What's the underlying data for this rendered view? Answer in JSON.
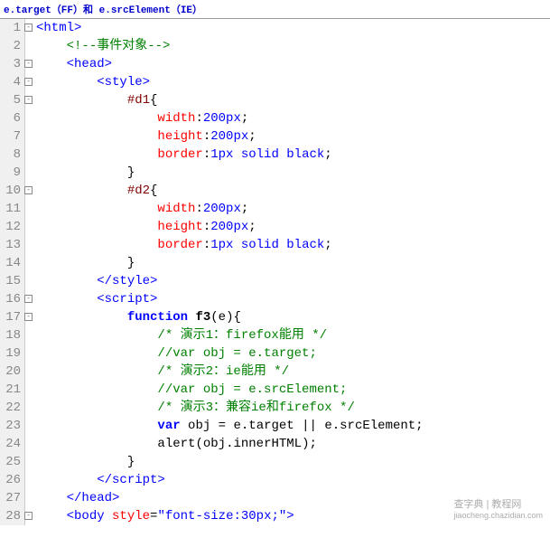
{
  "header": "e.target（FF）和 e.srcElement（IE）",
  "watermark": {
    "line1": "查字典 | 教程网",
    "line2": "jiaocheng.chazidian.com"
  },
  "lines": [
    {
      "num": "1",
      "fold": true,
      "html": "<span class='t-tag'>&lt;html&gt;</span>"
    },
    {
      "num": "2",
      "fold": false,
      "html": "    <span class='t-comment'>&lt;!--事件对象--&gt;</span>"
    },
    {
      "num": "3",
      "fold": true,
      "html": "    <span class='t-tag'>&lt;head&gt;</span>"
    },
    {
      "num": "4",
      "fold": true,
      "html": "        <span class='t-tag'>&lt;style&gt;</span>"
    },
    {
      "num": "5",
      "fold": true,
      "html": "            <span class='t-selector'>#d1</span><span class='t-punct'>{</span>"
    },
    {
      "num": "6",
      "fold": false,
      "html": "                <span class='t-prop'>width</span><span class='t-punct'>:</span><span class='t-val'>200px</span><span class='t-punct'>;</span>"
    },
    {
      "num": "7",
      "fold": false,
      "html": "                <span class='t-prop'>height</span><span class='t-punct'>:</span><span class='t-val'>200px</span><span class='t-punct'>;</span>"
    },
    {
      "num": "8",
      "fold": false,
      "html": "                <span class='t-prop'>border</span><span class='t-punct'>:</span><span class='t-val'>1px solid black</span><span class='t-punct'>;</span>"
    },
    {
      "num": "9",
      "fold": false,
      "html": "            <span class='t-punct'>}</span>"
    },
    {
      "num": "10",
      "fold": true,
      "html": "            <span class='t-selector'>#d2</span><span class='t-punct'>{</span>"
    },
    {
      "num": "11",
      "fold": false,
      "html": "                <span class='t-prop'>width</span><span class='t-punct'>:</span><span class='t-val'>200px</span><span class='t-punct'>;</span>"
    },
    {
      "num": "12",
      "fold": false,
      "html": "                <span class='t-prop'>height</span><span class='t-punct'>:</span><span class='t-val'>200px</span><span class='t-punct'>;</span>"
    },
    {
      "num": "13",
      "fold": false,
      "html": "                <span class='t-prop'>border</span><span class='t-punct'>:</span><span class='t-val'>1px solid black</span><span class='t-punct'>;</span>"
    },
    {
      "num": "14",
      "fold": false,
      "html": "            <span class='t-punct'>}</span>"
    },
    {
      "num": "15",
      "fold": false,
      "html": "        <span class='t-tag'>&lt;/style&gt;</span>"
    },
    {
      "num": "16",
      "fold": true,
      "html": "        <span class='t-tag'>&lt;script&gt;</span>"
    },
    {
      "num": "17",
      "fold": true,
      "html": "            <span class='t-kw'>function</span> <span class='t-func'>f3</span><span class='t-punct'>(</span><span class='t-id'>e</span><span class='t-punct'>){</span>"
    },
    {
      "num": "18",
      "fold": false,
      "html": "                <span class='t-comment'>/* 演示1：firefox能用 */</span>"
    },
    {
      "num": "19",
      "fold": false,
      "html": "                <span class='t-comment'>//var obj = e.target;</span>"
    },
    {
      "num": "20",
      "fold": false,
      "html": "                <span class='t-comment'>/* 演示2：ie能用 */</span>"
    },
    {
      "num": "21",
      "fold": false,
      "html": "                <span class='t-comment'>//var obj = e.srcElement;</span>"
    },
    {
      "num": "22",
      "fold": false,
      "html": "                <span class='t-comment'>/* 演示3：兼容ie和firefox */</span>"
    },
    {
      "num": "23",
      "fold": false,
      "html": "                <span class='t-kw'>var</span> <span class='t-id'>obj</span> <span class='t-punct'>=</span> <span class='t-id'>e</span><span class='t-punct'>.</span><span class='t-id'>target</span> <span class='t-punct'>||</span> <span class='t-id'>e</span><span class='t-punct'>.</span><span class='t-id'>srcElement</span><span class='t-punct'>;</span>"
    },
    {
      "num": "24",
      "fold": false,
      "html": "                <span class='t-id'>alert</span><span class='t-punct'>(</span><span class='t-id'>obj</span><span class='t-punct'>.</span><span class='t-id'>innerHTML</span><span class='t-punct'>);</span>"
    },
    {
      "num": "25",
      "fold": false,
      "html": "            <span class='t-punct'>}</span>"
    },
    {
      "num": "26",
      "fold": false,
      "html": "        <span class='t-tag'>&lt;/script&gt;</span>"
    },
    {
      "num": "27",
      "fold": false,
      "html": "    <span class='t-tag'>&lt;/head&gt;</span>"
    },
    {
      "num": "28",
      "fold": true,
      "html": "    <span class='t-tag'>&lt;body</span> <span class='t-attr'>style</span><span class='t-punct'>=</span><span class='t-str'>\"font-size:30px;\"</span><span class='t-tag'>&gt;</span>"
    }
  ]
}
